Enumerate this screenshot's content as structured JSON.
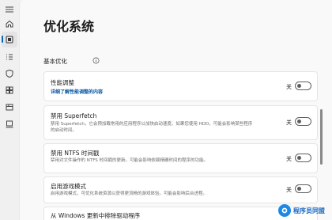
{
  "page": {
    "title": "优化系统"
  },
  "rail": {
    "items": [
      {
        "icon": "hamburger-menu-icon"
      },
      {
        "icon": "home-icon"
      },
      {
        "icon": "optimize-icon",
        "active": true
      },
      {
        "icon": "list-icon"
      },
      {
        "icon": "shield-icon"
      },
      {
        "icon": "apps-icon"
      },
      {
        "icon": "package-icon"
      },
      {
        "icon": "device-icon"
      }
    ]
  },
  "section": {
    "header": "基本优化",
    "info_icon": "info-icon"
  },
  "cards": [
    {
      "title": "性能调整",
      "link": "详细了解性能调整的内容",
      "toggle_label": "关",
      "toggle_on": false
    },
    {
      "title": "禁用 Superfetch",
      "desc": "禁用 Superfetch，它会预加载常用的应用程序以加快启动速度。如果您使用 HDD，可能会影响某些程序的启动时间。",
      "toggle_label": "关",
      "toggle_on": false
    },
    {
      "title": "禁用 NTFS 时间戳",
      "desc": "禁用对文件操作的 NTFS 时间戳的更新。可能会影响依赖精确时间的程序的功能。",
      "toggle_label": "关",
      "toggle_on": false
    },
    {
      "title": "启用游戏模式",
      "desc": "启用游戏模式，可优化系统资源以获得更流畅的游戏体验。可能会影响后台进程。",
      "toggle_label": "关",
      "toggle_on": false
    },
    {
      "title": "从 Windows 更新中排除驱动程序"
    }
  ],
  "watermark": {
    "text": "程序员同盟"
  },
  "colors": {
    "accent": "#0067c0",
    "link": "#0054a6"
  }
}
